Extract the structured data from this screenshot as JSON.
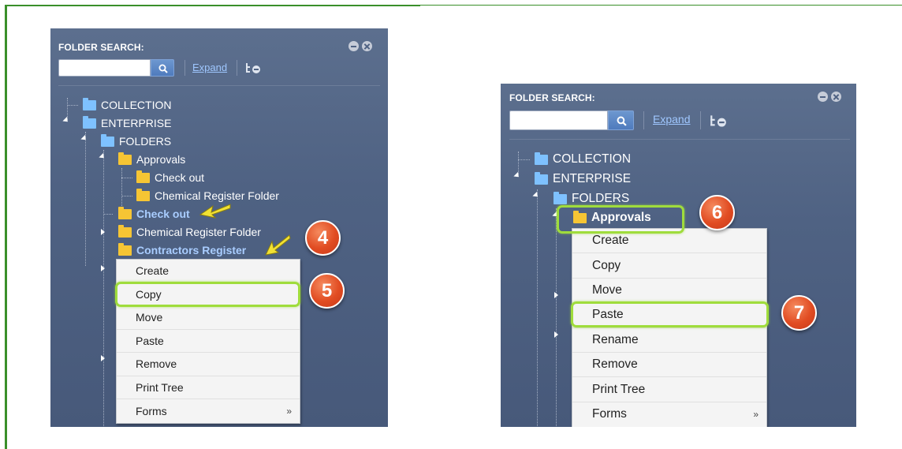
{
  "panel_left": {
    "title": "FOLDER SEARCH:",
    "search_placeholder": "",
    "expand_label": "Expand",
    "tree": {
      "collection": "COLLECTION",
      "enterprise": "ENTERPRISE",
      "folders": "FOLDERS",
      "approvals": "Approvals",
      "approvals_check_out": "Check out",
      "approvals_chemical": "Chemical Register Folder",
      "check_out": "Check out",
      "chemical_register": "Chemical Register Folder",
      "contractors_register": "Contractors Register"
    },
    "menu": [
      "Create",
      "Copy",
      "Move",
      "Paste",
      "Remove",
      "Print Tree",
      "Forms"
    ],
    "submenu_arrow": "»",
    "badges": [
      "4",
      "5"
    ]
  },
  "panel_right": {
    "title": "FOLDER SEARCH:",
    "search_placeholder": "",
    "expand_label": "Expand",
    "tree": {
      "collection": "COLLECTION",
      "enterprise": "ENTERPRISE",
      "folders": "FOLDERS",
      "approvals": "Approvals"
    },
    "menu": [
      "Create",
      "Copy",
      "Move",
      "Paste",
      "Rename",
      "Remove",
      "Print Tree",
      "Forms"
    ],
    "submenu_arrow": "»",
    "badges": [
      "6",
      "7"
    ]
  },
  "colors": {
    "panel_bg": "#4f6283",
    "highlight": "#9fdc3c",
    "badge": "#e14c22",
    "folder_blue": "#7ec1ff",
    "folder_yellow": "#f6c534",
    "frame_green": "#3a8f2a"
  }
}
